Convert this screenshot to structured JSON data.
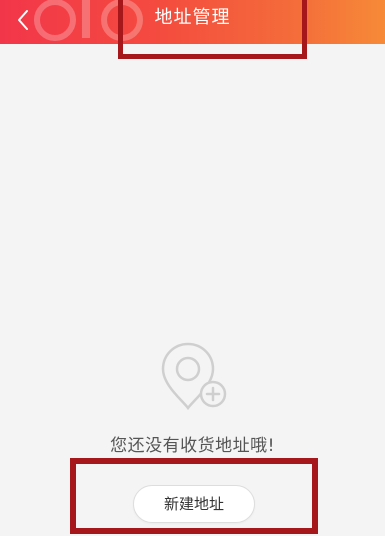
{
  "header": {
    "title": "地址管理",
    "back_icon": "chevron-left-icon",
    "gradient_start": "#f2364a",
    "gradient_end": "#f68a38"
  },
  "empty_state": {
    "icon": "location-pin-add-icon",
    "message": "您还没有收货地址哦!"
  },
  "actions": {
    "new_address_label": "新建地址"
  },
  "annotations": {
    "highlight_color": "#a5171a"
  }
}
